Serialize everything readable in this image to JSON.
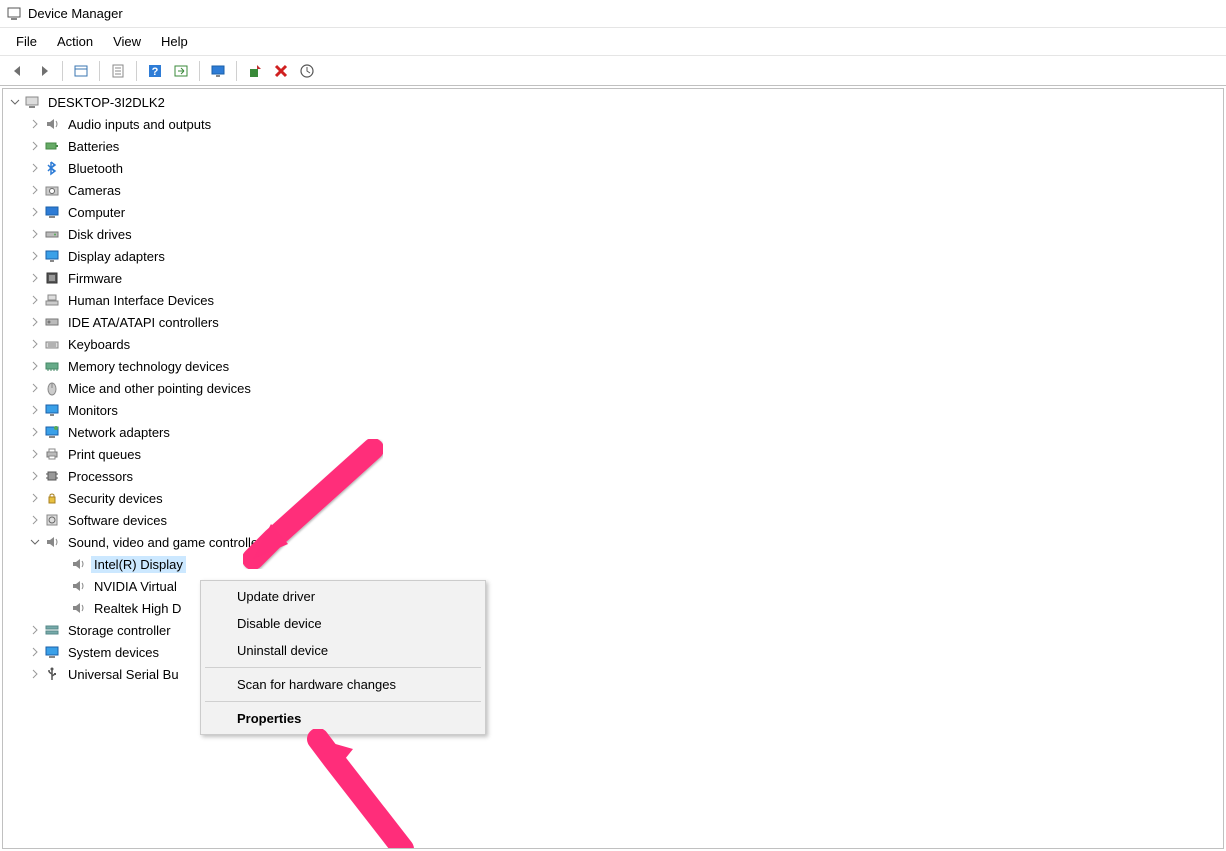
{
  "titlebar": {
    "title": "Device Manager"
  },
  "menubar": {
    "items": [
      "File",
      "Action",
      "View",
      "Help"
    ]
  },
  "toolbar": {
    "buttons": [
      "back",
      "forward",
      "sep",
      "show-hidden",
      "sep",
      "properties",
      "sep",
      "help",
      "action",
      "sep",
      "monitor",
      "sep",
      "update-driver",
      "uninstall",
      "scan"
    ]
  },
  "tree": {
    "root": {
      "label": "DESKTOP-3I2DLK2",
      "expanded": true
    },
    "categories": [
      {
        "label": "Audio inputs and outputs",
        "icon": "speaker"
      },
      {
        "label": "Batteries",
        "icon": "battery"
      },
      {
        "label": "Bluetooth",
        "icon": "bluetooth"
      },
      {
        "label": "Cameras",
        "icon": "camera"
      },
      {
        "label": "Computer",
        "icon": "computer"
      },
      {
        "label": "Disk drives",
        "icon": "disk"
      },
      {
        "label": "Display adapters",
        "icon": "display"
      },
      {
        "label": "Firmware",
        "icon": "firmware"
      },
      {
        "label": "Human Interface Devices",
        "icon": "hid"
      },
      {
        "label": "IDE ATA/ATAPI controllers",
        "icon": "ide"
      },
      {
        "label": "Keyboards",
        "icon": "keyboard"
      },
      {
        "label": "Memory technology devices",
        "icon": "memory"
      },
      {
        "label": "Mice and other pointing devices",
        "icon": "mouse"
      },
      {
        "label": "Monitors",
        "icon": "monitor"
      },
      {
        "label": "Network adapters",
        "icon": "network"
      },
      {
        "label": "Print queues",
        "icon": "printer"
      },
      {
        "label": "Processors",
        "icon": "cpu"
      },
      {
        "label": "Security devices",
        "icon": "security"
      },
      {
        "label": "Software devices",
        "icon": "software"
      },
      {
        "label": "Sound, video and game controllers",
        "icon": "speaker",
        "expanded": true,
        "children": [
          {
            "label": "Intel(R) Display Audio",
            "icon": "speaker",
            "selected": true,
            "truncated_display": "Intel(R) Display"
          },
          {
            "label": "NVIDIA Virtual Audio Device",
            "icon": "speaker",
            "truncated_display": "NVIDIA Virtual"
          },
          {
            "label": "Realtek High Definition Audio",
            "icon": "speaker",
            "truncated_display": "Realtek High D"
          }
        ]
      },
      {
        "label": "Storage controllers",
        "icon": "storage",
        "truncated_display": "Storage controller"
      },
      {
        "label": "System devices",
        "icon": "system"
      },
      {
        "label": "Universal Serial Bus controllers",
        "icon": "usb",
        "truncated_display": "Universal Serial Bu"
      }
    ]
  },
  "context_menu": {
    "items": [
      {
        "label": "Update driver"
      },
      {
        "label": "Disable device"
      },
      {
        "label": "Uninstall device"
      },
      {
        "sep": true
      },
      {
        "label": "Scan for hardware changes"
      },
      {
        "sep": true
      },
      {
        "label": "Properties",
        "bold": true
      }
    ]
  },
  "annotations": {
    "arrow1": {
      "points_to": "Sound, video and game controllers"
    },
    "arrow2": {
      "points_to": "Properties context-menu item"
    }
  }
}
